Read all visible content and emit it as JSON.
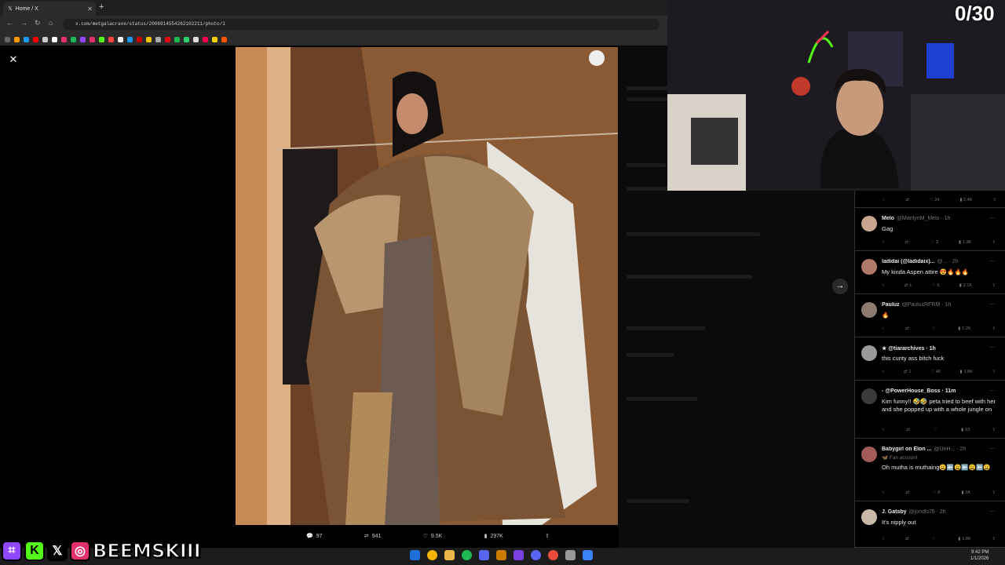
{
  "browser": {
    "tab_title": "Home / X",
    "url": "x.com/metgalacrave/status/2006914554262102211/photo/1"
  },
  "viewer": {
    "close_glyph": "✕",
    "next_glyph": "→",
    "actions": {
      "replies": "97",
      "reposts": "941",
      "likes": "9.5K",
      "views": "297K"
    }
  },
  "top_stats": {
    "likes": "24",
    "views": "2.4K"
  },
  "replies": [
    {
      "name": "Melo",
      "handle": "@MarilynM_Melo · 1h",
      "text": "Gag",
      "reposts": "",
      "likes": "3",
      "views": "1.3K",
      "avatar_color": "#c9a48f"
    },
    {
      "name": "ladidai (@ladidaix)...",
      "handle": "@... · 2h",
      "text": "My kinda Aspen attire 😍🔥🔥🔥",
      "reposts": "1",
      "likes": "6",
      "views": "2.1K",
      "avatar_color": "#b07a6a"
    },
    {
      "name": "Pauluz",
      "handle": "@PauluzRFRM · 1h",
      "text": "🔥",
      "reposts": "",
      "likes": "",
      "views": "1.2K",
      "avatar_color": "#8d7a70"
    },
    {
      "name": "★ @tiararchives · 1h",
      "handle": "",
      "text": "this cunty ass bitch fuck",
      "reposts": "1",
      "likes": "46",
      "views": "1.8K",
      "avatar_color": "#9a9a9a"
    },
    {
      "name": "- @PowerHouse_Boss · 11m",
      "handle": "",
      "text": "Kim funny!! 🤣🤣 peta tried to beef with her and she popped up with a whole jungle on",
      "reposts": "",
      "likes": "",
      "views": "93",
      "avatar_color": "#3a3a3a"
    },
    {
      "name": "Babygirl on Elon ...",
      "handle": "@UnH... · 2h",
      "sub": "🦋 Fan account",
      "text": "Oh mutha is muthaing😩⬅️😩⬅️😩⬅️😩",
      "reposts": "",
      "likes": "8",
      "views": "3K",
      "avatar_color": "#a35a5a"
    },
    {
      "name": "J. Gatsby",
      "handle": "@jondls76 · 2h",
      "text": "It's nipply out",
      "reposts": "",
      "likes": "",
      "views": "1.8K",
      "avatar_color": "#c8b8a8"
    }
  ],
  "stream": {
    "counter": "0/30",
    "handle": "BEEMSKIII",
    "social_icons": [
      "twitch-icon",
      "kick-icon",
      "x-icon",
      "instagram-icon"
    ]
  },
  "taskbar": {
    "time": "9:42 PM",
    "date": "1/1/2026"
  },
  "colors": {
    "x_blue": "#1d9bf0",
    "twitch_purple": "#9146ff",
    "kick_green": "#53fc18"
  }
}
